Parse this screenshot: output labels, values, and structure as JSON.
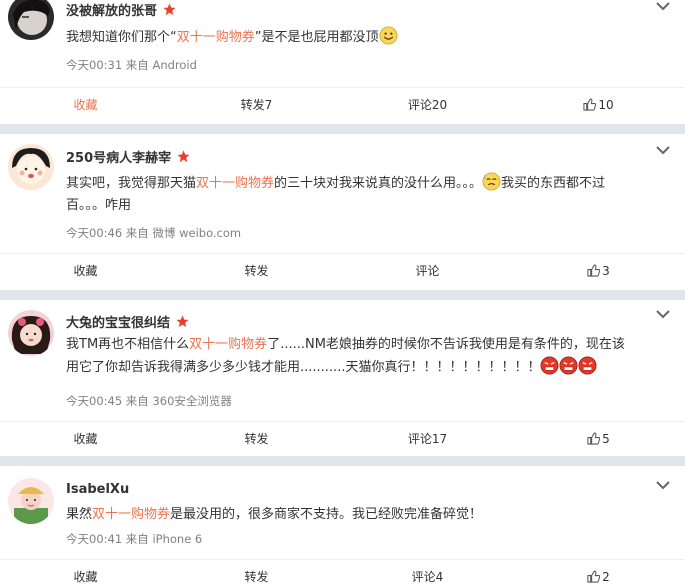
{
  "posts": [
    {
      "name": "没被解放的张哥",
      "text_before": "我想知道你们那个“",
      "highlight": "双十一购物券",
      "text_after": "”是不是也屁用都没顶",
      "meta": "今天00:31 来自 Android",
      "actions": {
        "fav": "收藏",
        "repost": "转发7",
        "comment": "评论20",
        "like": "10"
      }
    },
    {
      "name": "250号病人李赫宰",
      "text_before": "其实吧，我觉得那天猫",
      "highlight": "双十一购物券",
      "text_after": "的三十块对我来说真的没什么用。。。",
      "text_after2": "我买的东西都不过",
      "text_line2": "百。。。咋用",
      "meta": "今天00:46 来自 微博 weibo.com",
      "actions": {
        "fav": "收藏",
        "repost": "转发",
        "comment": "评论",
        "like": "3"
      }
    },
    {
      "name": "大兔的宝宝很纠结",
      "text_before": "我TM再也不相信什么",
      "highlight": "双十一购物券",
      "text_after": "了......NM老娘抽券的时候你不告诉我使用是有条件的，现在该",
      "text_line2": "用它了你却告诉我得满多少多少钱才能用...........天猫你真行！！！！！！！！！！",
      "meta": "今天00:45 来自 360安全浏览器",
      "actions": {
        "fav": "收藏",
        "repost": "转发",
        "comment": "评论17",
        "like": "5"
      }
    },
    {
      "name": "IsabelXu",
      "text_before": "果然",
      "highlight": "双十一购物券",
      "text_after": "是最没用的，很多商家不支持。我已经败完准备碎觉！",
      "meta": "今天00:41 来自 iPhone 6",
      "actions": {
        "fav": "收藏",
        "repost": "转发",
        "comment": "评论4",
        "like": "2"
      }
    }
  ],
  "colors": {
    "highlight": "#eb7350",
    "star": "#e8402d",
    "meta": "#808080",
    "gap": "#e1e5ec"
  }
}
